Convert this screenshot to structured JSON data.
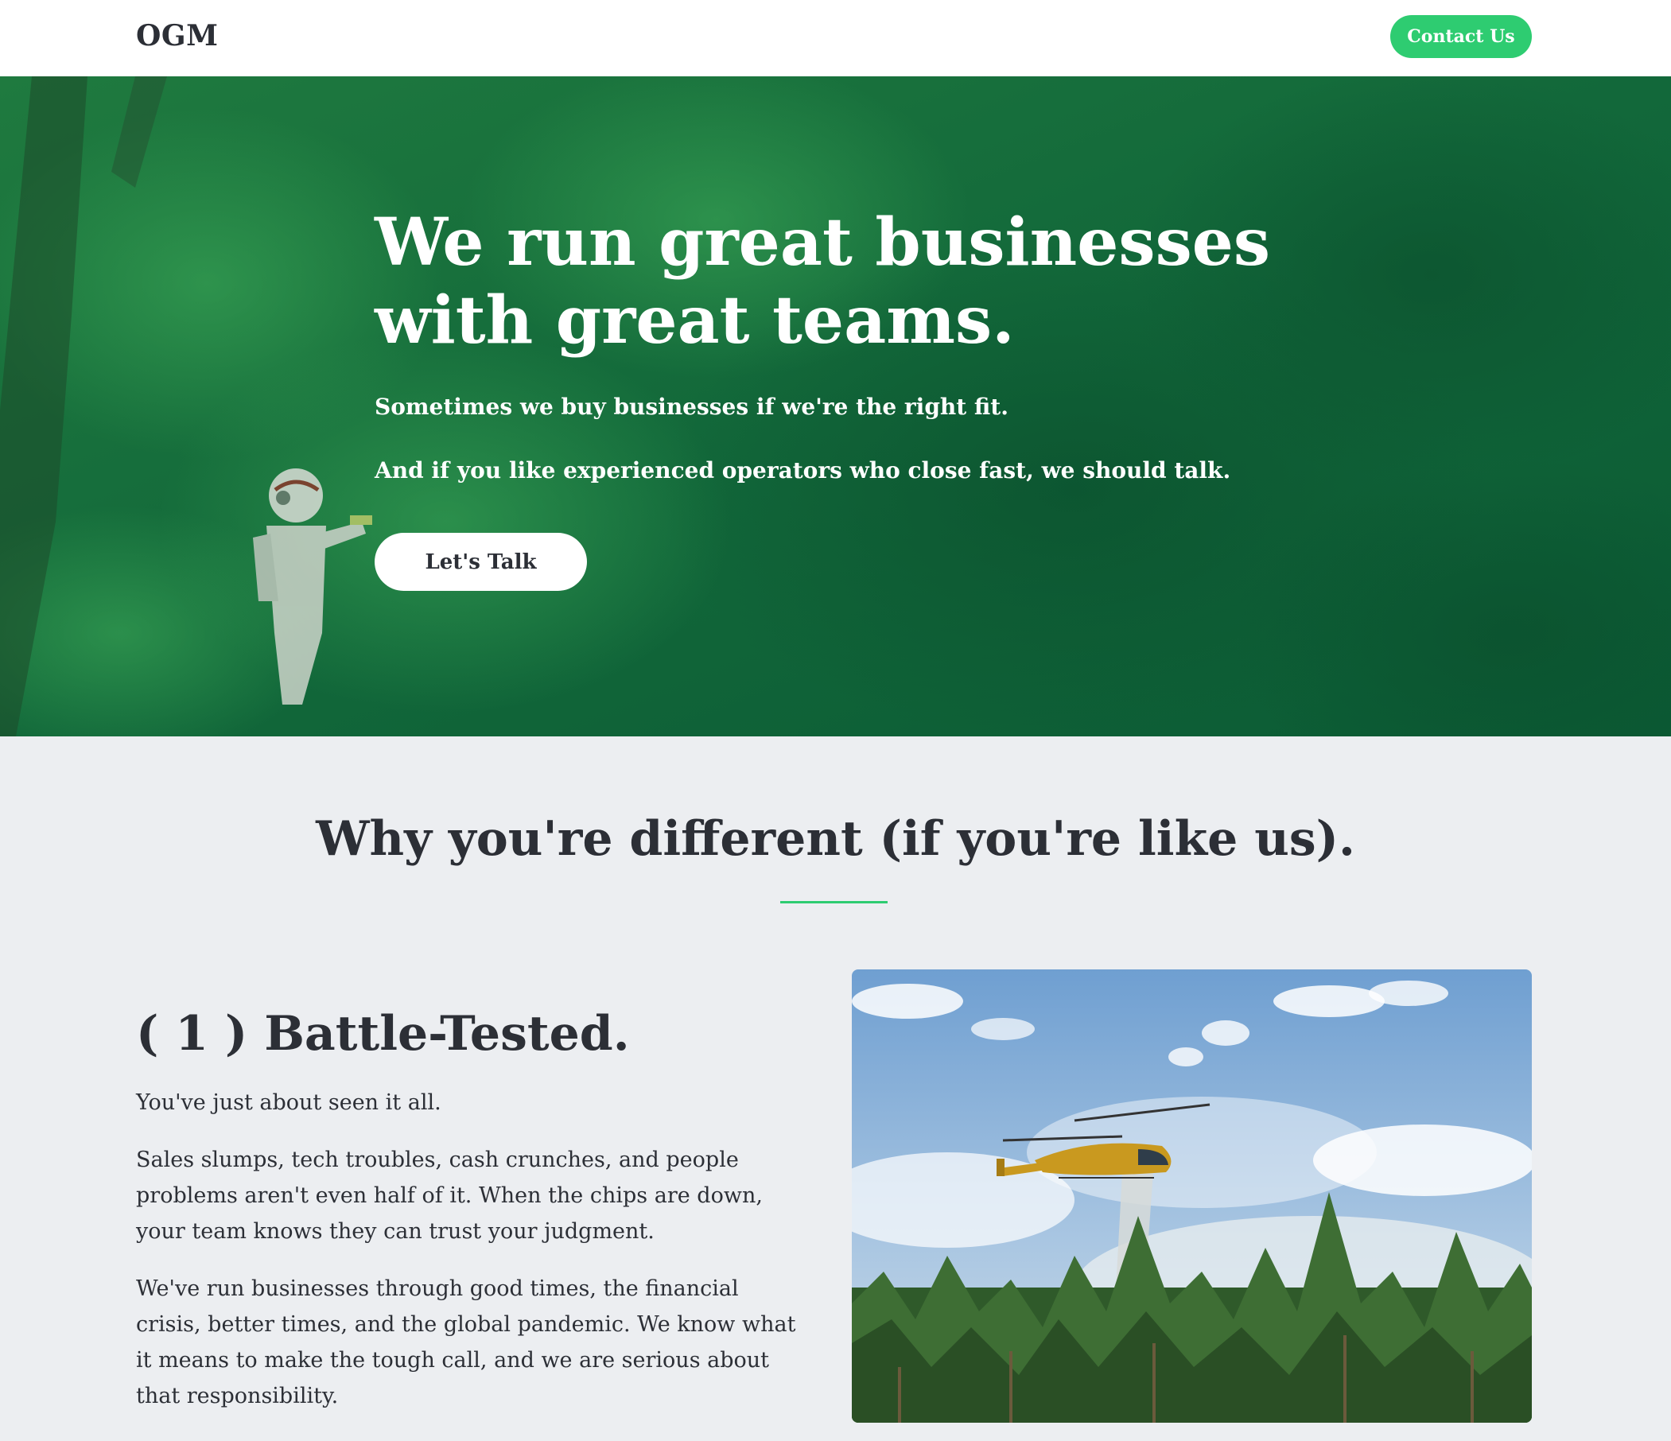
{
  "navbar": {
    "brand": "OGM",
    "contact_label": "Contact Us"
  },
  "hero": {
    "title": "We run great businesses with great teams.",
    "subtitle": "Sometimes we buy businesses if we're the right fit.",
    "subtitle2": "And if you like experienced operators who close fast, we should talk.",
    "cta_label": "Let's Talk",
    "background": "forest-with-astronaut-photo"
  },
  "section": {
    "title": "Why you're different (if you're like us).",
    "accent_color": "#2ecc71"
  },
  "feature": {
    "title": "( 1 ) Battle-Tested.",
    "paragraphs": [
      "You've just about seen it all.",
      "Sales slumps, tech troubles, cash crunches, and people problems aren't even half of it. When the chips are down, your team knows they can trust your judgment.",
      "We've run businesses through good times, the financial crisis, better times, and the global pandemic. We know what it means to make the tough call, and we are serious about that responsibility."
    ],
    "image": "firefighting-helicopter-over-pine-trees-photo"
  },
  "colors": {
    "brand_green": "#2ecc71",
    "hero_overlay": "#0f6b3d",
    "text_dark": "#2c2f36",
    "page_bg": "#eceef1"
  }
}
